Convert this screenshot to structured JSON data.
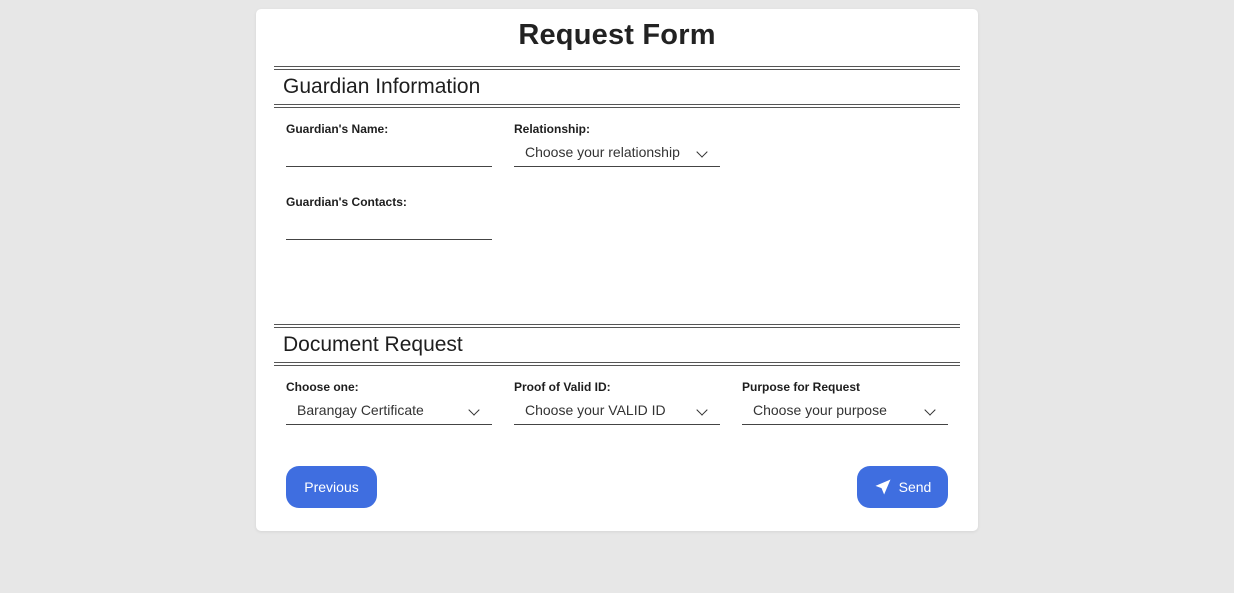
{
  "form": {
    "title": "Request Form"
  },
  "guardian_section": {
    "title": "Guardian Information",
    "name_label": "Guardian's Name:",
    "name_value": "",
    "relationship_label": "Relationship:",
    "relationship_value": "Choose your relationship",
    "contacts_label": "Guardian's Contacts:",
    "contacts_value": ""
  },
  "document_section": {
    "title": "Document Request",
    "choose_label": "Choose one:",
    "choose_value": "Barangay Certificate",
    "valid_id_label": "Proof of Valid ID:",
    "valid_id_value": "Choose your VALID ID",
    "purpose_label": "Purpose for Request",
    "purpose_value": "Choose your purpose"
  },
  "actions": {
    "previous_label": "Previous",
    "send_label": "Send",
    "send_icon": "paper-plane-icon"
  },
  "colors": {
    "accent": "#3f6ee0",
    "background": "#e7e7e7",
    "card": "#ffffff"
  }
}
